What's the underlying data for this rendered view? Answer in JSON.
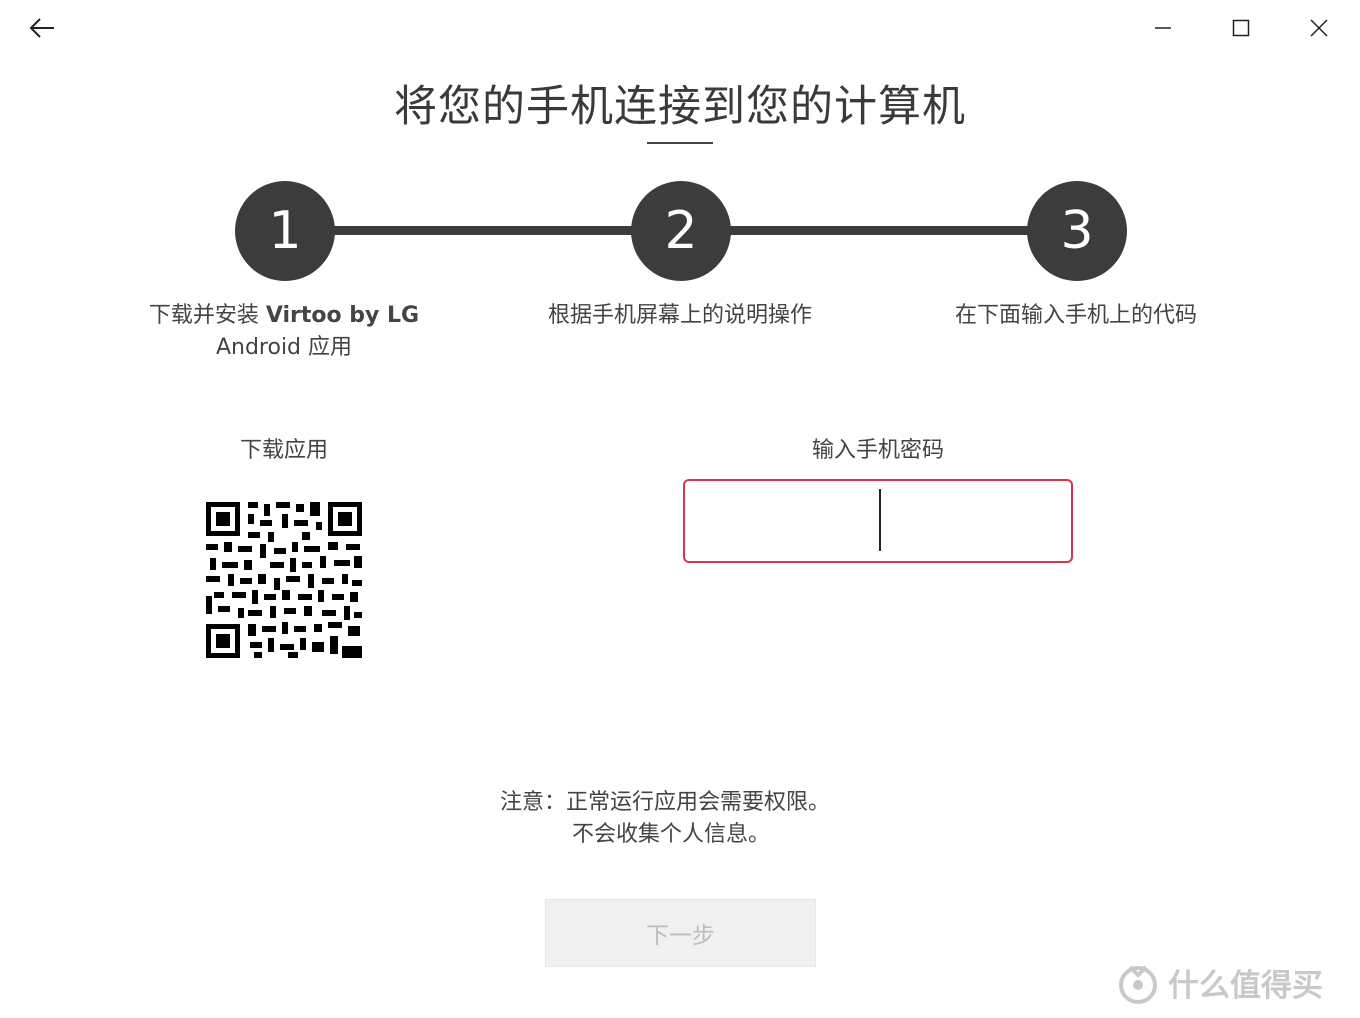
{
  "window": {
    "back_icon": "arrow-left-icon",
    "minimize_icon": "minimize-icon",
    "maximize_icon": "maximize-icon",
    "close_icon": "close-icon"
  },
  "title": "将您的手机连接到您的计算机",
  "steps": [
    {
      "number": "1",
      "caption_prefix": "下载并安装 ",
      "caption_bold": "Virtoo by LG",
      "caption_line2": "Android 应用"
    },
    {
      "number": "2",
      "caption": "根据手机屏幕上的说明操作"
    },
    {
      "number": "3",
      "caption": "在下面输入手机上的代码"
    }
  ],
  "download": {
    "label": "下载应用",
    "qr_icon": "qr-code-icon"
  },
  "code_entry": {
    "label": "输入手机密码",
    "value": ""
  },
  "notice": {
    "prefix": "注意：",
    "line1": "正常运行应用会需要权限。",
    "line2": "不会收集个人信息。"
  },
  "next_button": {
    "label": "下一步",
    "enabled": false
  },
  "watermark": {
    "text": "什么值得买"
  },
  "colors": {
    "accent_border": "#e0334a",
    "step_fill": "#3c3c3c",
    "disabled_bg": "#f0f0f0"
  }
}
